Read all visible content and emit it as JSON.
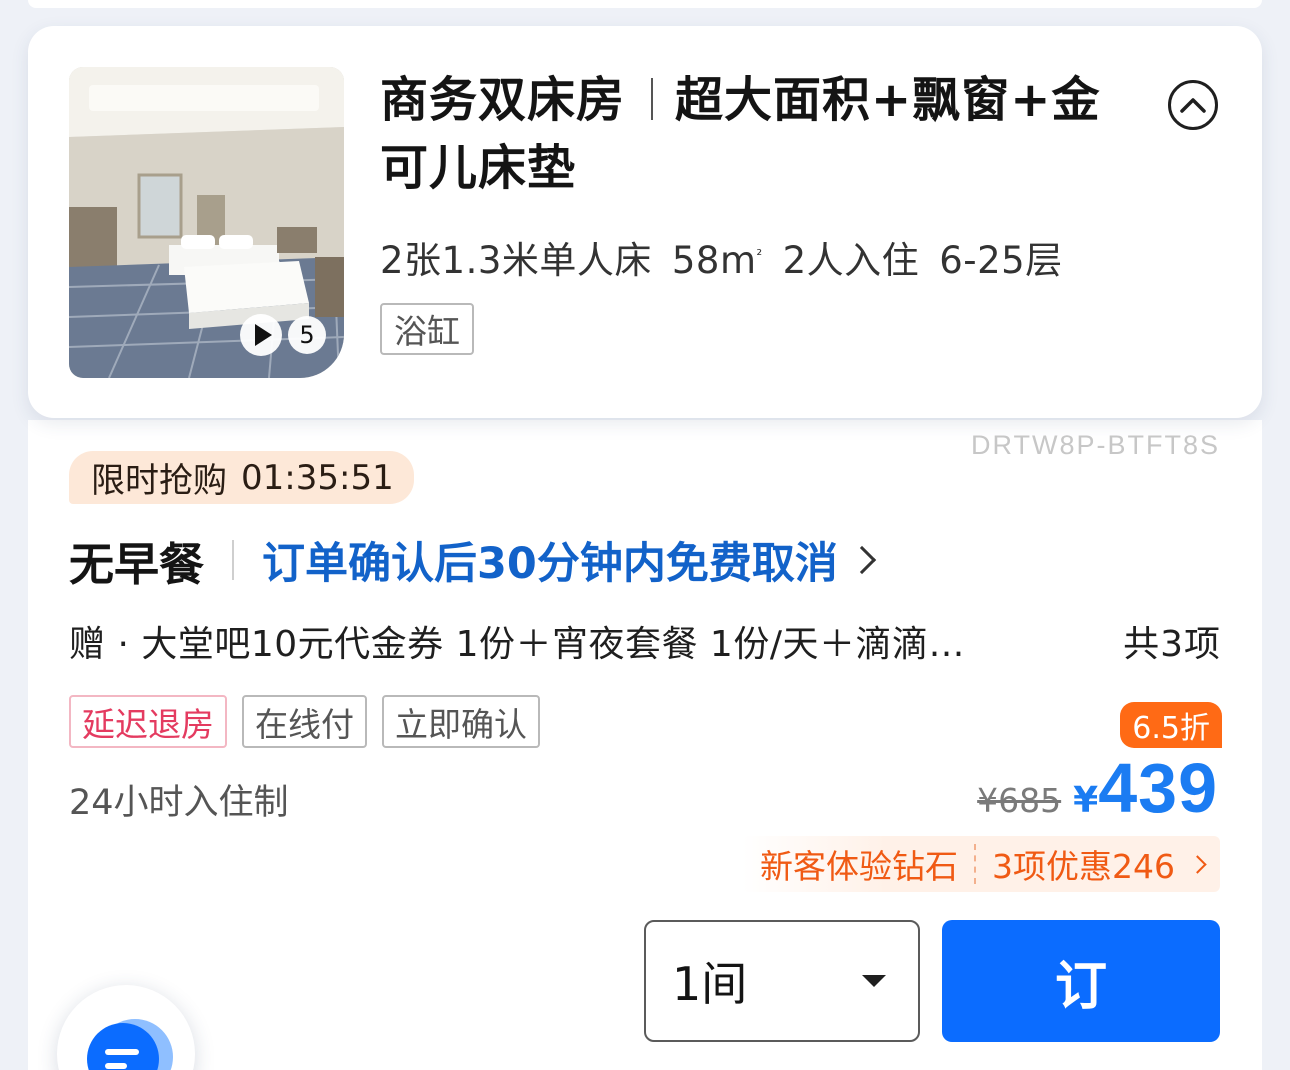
{
  "room": {
    "title_main": "商务双床房",
    "title_detail": "超大面积+飘窗+金可儿床垫",
    "specs": {
      "bed": "2张1.3米单人床",
      "area": "58m",
      "area_unit_sup": "²",
      "occupancy": "2人入住",
      "floors": "6-25层"
    },
    "facility_tag": "浴缸",
    "media_count": "5",
    "icons": {
      "collapse": "chevron-up-circle-icon",
      "play": "play-icon"
    }
  },
  "rate": {
    "code": "DRTW8P-BTFT8S",
    "flash_sale": {
      "label": "限时抢购",
      "countdown": "01:35:51"
    },
    "meal": "无早餐",
    "cancel_policy": "订单确认后30分钟内免费取消",
    "gifts": "赠 · 大堂吧10元代金券 1份＋宵夜套餐 1份/天＋滴滴…",
    "gifts_total": "共3项",
    "tags": [
      "延迟退房",
      "在线付",
      "立即确认"
    ],
    "checkin_policy": "24小时入住制",
    "discount": "6.5折",
    "original_price": "¥685",
    "currency": "¥",
    "price": "439",
    "promo_member": "新客体验钻石",
    "promo_discount": "3项优惠246"
  },
  "booking": {
    "quantity": "1间",
    "book_label": "订"
  },
  "colors": {
    "accent_blue": "#0b6cff",
    "price_blue": "#1b7cf2",
    "link_blue": "#1262c9",
    "discount_orange": "#ff6a15",
    "tag_red": "#e43b60"
  }
}
